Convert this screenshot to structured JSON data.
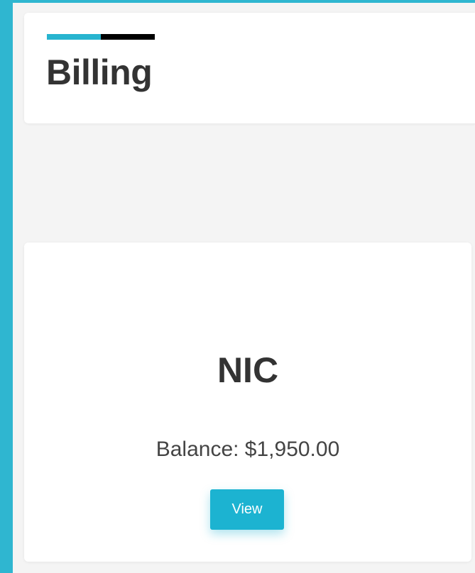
{
  "header": {
    "title": "Billing",
    "accent_colors": [
      "#27b4cf",
      "#000000"
    ]
  },
  "accounts": [
    {
      "name": "NIC",
      "balance_text": "Balance: $1,950.00",
      "view_label": "View"
    }
  ],
  "theme": {
    "rail_color": "#2fb6d0",
    "button_color": "#1cb3d1",
    "background": "#f4f4f4"
  }
}
